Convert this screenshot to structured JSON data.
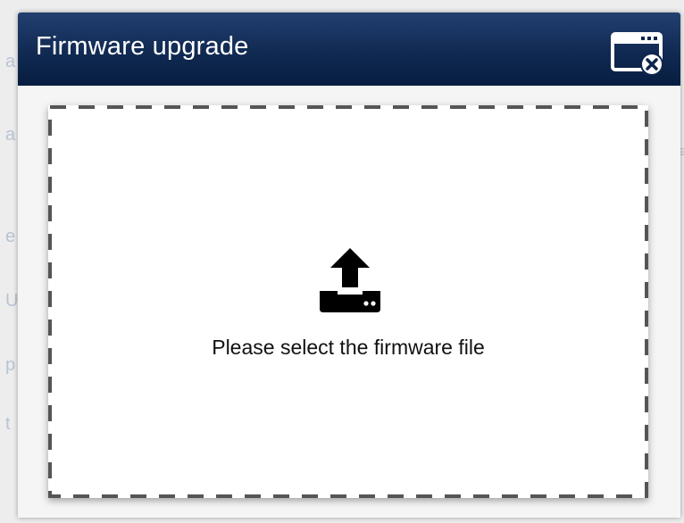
{
  "window": {
    "background_color": "#e4e4e4"
  },
  "dialog": {
    "title": "Firmware upgrade",
    "header_color": "#0d264c",
    "close_icon": "close-window-icon"
  },
  "drop_zone": {
    "icon": "upload-tray-icon",
    "label": "Please select the firmware file",
    "border_color": "#555555"
  }
}
